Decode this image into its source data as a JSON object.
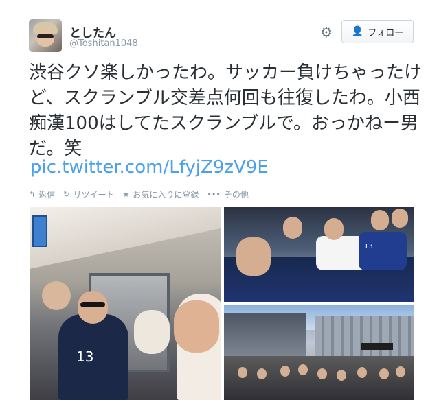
{
  "user": {
    "full_name": "としたん",
    "screen_name": "@Toshitan1048"
  },
  "header": {
    "follow_label": "フォロー"
  },
  "tweet": {
    "text": "渋谷クソ楽しかったわ。サッカー負けちゃったけど、スクランブル交差点何回も往復したわ。小西痴漢100はしてたスクランブルで。おっかねー男だ。笑",
    "link": "pic.twitter.com/LfyjZ9zV9E"
  },
  "actions": {
    "reply": "返信",
    "retweet": "リツイート",
    "favorite": "お気に入りに登録",
    "more": "その他"
  },
  "icons": {
    "gear": "gear-icon",
    "follow": "person-add-icon",
    "reply": "reply-icon",
    "retweet": "retweet-icon",
    "favorite": "star-icon",
    "more": "more-icon"
  },
  "photos": {
    "left": {
      "jersey_number": "13"
    },
    "top_right": {
      "jersey_number": "13"
    }
  },
  "colors": {
    "link": "#4aa1ea",
    "text": "#292f33",
    "muted": "#8899a6",
    "border": "#ccd6dd"
  }
}
